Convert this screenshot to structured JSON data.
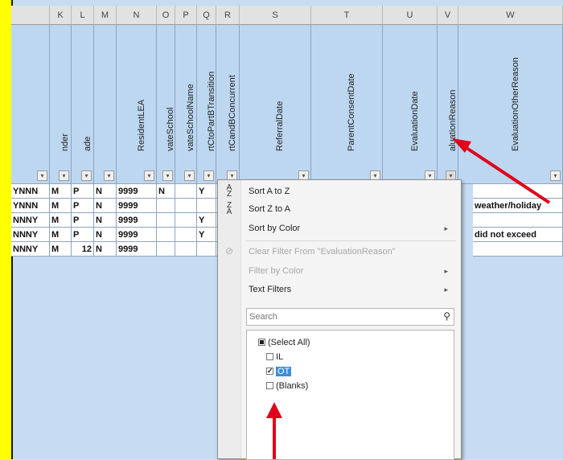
{
  "columns": [
    {
      "letter": "",
      "header": ""
    },
    {
      "letter": "K",
      "header": "nder"
    },
    {
      "letter": "L",
      "header": "ade"
    },
    {
      "letter": "M",
      "header": ""
    },
    {
      "letter": "N",
      "header": "ResidentLEA"
    },
    {
      "letter": "O",
      "header": "vateSchool"
    },
    {
      "letter": "P",
      "header": "vateSchoolName"
    },
    {
      "letter": "Q",
      "header": "rtCtoPartBTransition"
    },
    {
      "letter": "R",
      "header": "rtCandBConcurrent"
    },
    {
      "letter": "S",
      "header": "ReferralDate"
    },
    {
      "letter": "T",
      "header": "ParentConsentDate"
    },
    {
      "letter": "U",
      "header": "EvaluationDate"
    },
    {
      "letter": "V",
      "header": "aluationReason"
    },
    {
      "letter": "W",
      "header": "EvaluationOtherReason"
    }
  ],
  "rows": [
    [
      "YNNN",
      "M",
      "P",
      "N",
      "9999",
      "N",
      "",
      "Y"
    ],
    [
      "YNNN",
      "M",
      "P",
      "N",
      "9999",
      "",
      "",
      ""
    ],
    [
      "NNNY",
      "M",
      "P",
      "N",
      "9999",
      "",
      "",
      "Y"
    ],
    [
      "NNNY",
      "M",
      "P",
      "N",
      "9999",
      "",
      "",
      "Y"
    ],
    [
      "NNNY",
      "M",
      "12",
      "N",
      "9999",
      "",
      "",
      ""
    ]
  ],
  "w_values": [
    "",
    "weather/holiday",
    "",
    "did not exceed",
    ""
  ],
  "menu": {
    "sort_az": "Sort A to Z",
    "sort_za": "Sort Z to A",
    "sort_by_color": "Sort by Color",
    "clear_filter": "Clear Filter From \"EvaluationReason\"",
    "filter_by_color": "Filter by Color",
    "text_filters": "Text Filters",
    "search_placeholder": "Search",
    "list_items": [
      {
        "label": "(Select All)",
        "state": "partial"
      },
      {
        "label": "IL",
        "state": "unchecked"
      },
      {
        "label": "OT",
        "state": "checked"
      },
      {
        "label": "(Blanks)",
        "state": "unchecked"
      }
    ]
  },
  "colors": {
    "sheet_bg": "#c5dcf3",
    "border_yellow": "#ffff00",
    "arrow_red": "#e0001b",
    "selected_item": "#3c8ddb"
  }
}
